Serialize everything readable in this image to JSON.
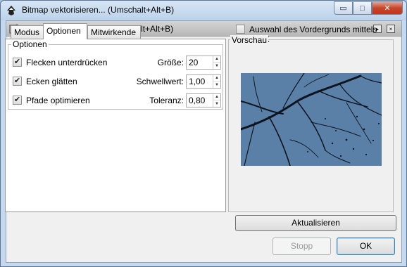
{
  "window": {
    "title": "Bitmap vektorisieren... (Umschalt+Alt+B)",
    "minimize_glyph": "▭",
    "maximize_glyph": "□",
    "close_glyph": "✕"
  },
  "dock": {
    "title": "Bitmap vektorisieren... (Umschalt+Alt+B)",
    "menu_glyph": "▸",
    "close_glyph": "×"
  },
  "tabs": [
    {
      "label": "Modus",
      "active": false
    },
    {
      "label": "Optionen",
      "active": true
    },
    {
      "label": "Mitwirkende",
      "active": false
    }
  ],
  "options": {
    "group_label": "Optionen",
    "rows": [
      {
        "checkbox_label": "Flecken unterdrücken",
        "checked": true,
        "field_label": "Größe:",
        "value": "20"
      },
      {
        "checkbox_label": "Ecken glätten",
        "checked": true,
        "field_label": "Schwellwert:",
        "value": "1,00"
      },
      {
        "checkbox_label": "Pfade optimieren",
        "checked": true,
        "field_label": "Toleranz:",
        "value": "0,80"
      }
    ]
  },
  "siox": {
    "label": "Auswahl des Vordergrunds mittels SIOX",
    "checked": false
  },
  "preview": {
    "label": "Vorschau",
    "update_button": "Aktualisieren"
  },
  "footer": {
    "stop_button": "Stopp",
    "ok_button": "OK"
  },
  "icons": {
    "app": "inkscape-icon",
    "check": "✔",
    "spin_up": "▲",
    "spin_down": "▼"
  },
  "colors": {
    "preview_sky": "#5a7fa6",
    "close_red": "#c53418"
  }
}
